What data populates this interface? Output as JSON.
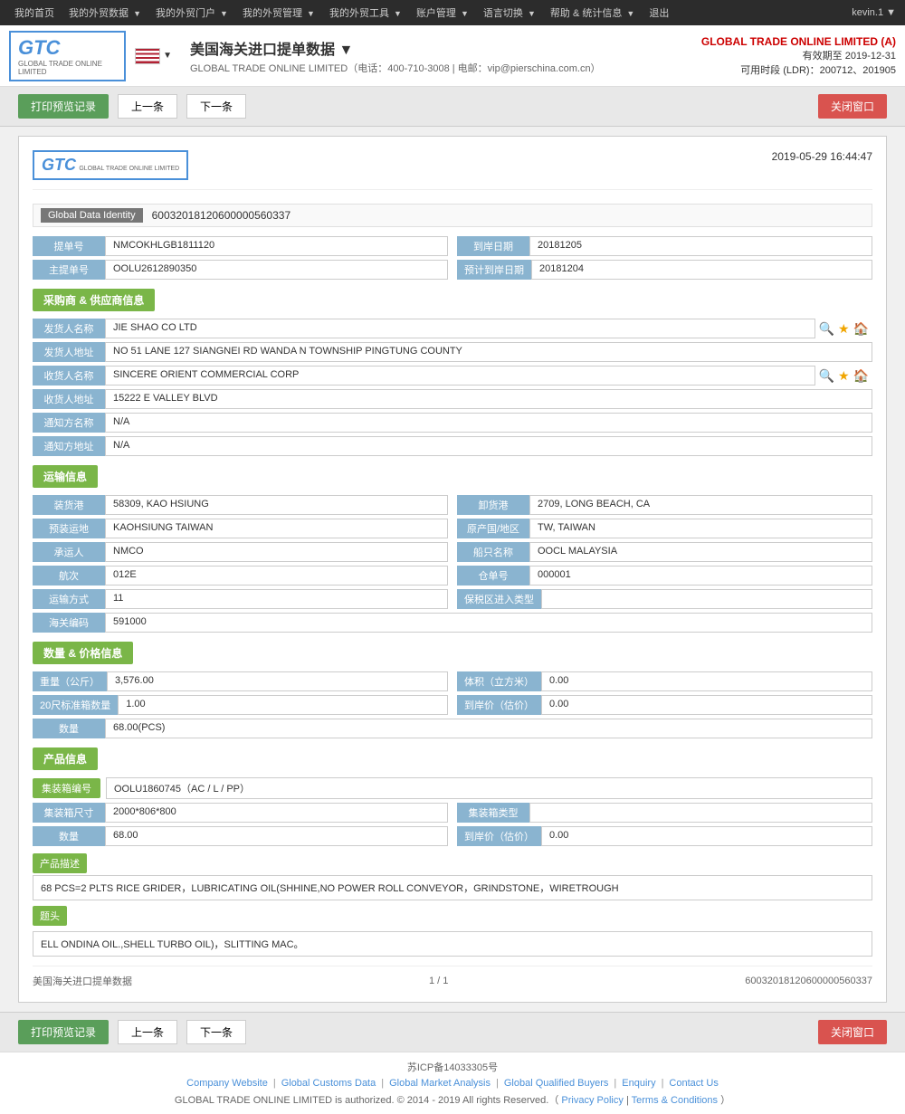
{
  "topnav": {
    "items": [
      {
        "label": "我的首页",
        "has_arrow": true
      },
      {
        "label": "我的外贸数据",
        "has_arrow": true
      },
      {
        "label": "我的外贸门户",
        "has_arrow": true
      },
      {
        "label": "我的外贸管理",
        "has_arrow": true
      },
      {
        "label": "我的外贸工具",
        "has_arrow": true
      },
      {
        "label": "账户管理",
        "has_arrow": true
      },
      {
        "label": "语言切换",
        "has_arrow": true
      },
      {
        "label": "帮助 & 统计信息",
        "has_arrow": true
      },
      {
        "label": "退出",
        "has_arrow": false
      }
    ],
    "user": "kevin.1 ▼"
  },
  "header": {
    "logo_main": "GTC",
    "logo_sub": "GLOBAL TRADE ONLINE LIMITED",
    "title": "美国海关进口提单数据",
    "title_suffix": "▼",
    "subtitle": "GLOBAL TRADE ONLINE LIMITED（电话：400-710-3008 | 电邮：vip@pierschina.com.cn）",
    "company": "GLOBAL TRADE ONLINE LIMITED (A)",
    "valid_until_label": "有效期至",
    "valid_until": "2019-12-31",
    "ldr_label": "可用时段 (LDR)：",
    "ldr_value": "200712、201905"
  },
  "toolbar_top": {
    "print_label": "打印预览记录",
    "prev_label": "上一条",
    "next_label": "下一条",
    "close_label": "关闭窗口"
  },
  "toolbar_bottom": {
    "print_label": "打印预览记录",
    "prev_label": "上一条",
    "next_label": "下一条",
    "close_label": "关闭窗口"
  },
  "card": {
    "logo_main": "GTC",
    "logo_sub": "GLOBAL TRADE ONLINE LIMITED",
    "datetime": "2019-05-29 16:44:47",
    "global_data_label": "Global Data Identity",
    "global_data_value": "60032018120600000560337",
    "bill_label": "提单号",
    "bill_value": "NMCOKHLGB1811120",
    "arrival_date_label": "到岸日期",
    "arrival_date_value": "20181205",
    "master_bill_label": "主提单号",
    "master_bill_value": "OOLU2612890350",
    "estimated_date_label": "预计到岸日期",
    "estimated_date_value": "20181204",
    "section_supplier": "采购商 & 供应商信息",
    "shipper_name_label": "发货人名称",
    "shipper_name_value": "JIE SHAO CO LTD",
    "shipper_addr_label": "发货人地址",
    "shipper_addr_value": "NO 51 LANE 127 SIANGNEI RD WANDA N TOWNSHIP PINGTUNG COUNTY",
    "consignee_name_label": "收货人名称",
    "consignee_name_value": "SINCERE ORIENT COMMERCIAL CORP",
    "consignee_addr_label": "收货人地址",
    "consignee_addr_value": "15222 E VALLEY BLVD",
    "notify_name_label": "通知方名称",
    "notify_name_value": "N/A",
    "notify_addr_label": "通知方地址",
    "notify_addr_value": "N/A",
    "section_transport": "运输信息",
    "loading_port_label": "装货港",
    "loading_port_value": "58309, KAO HSIUNG",
    "unloading_port_label": "卸货港",
    "unloading_port_value": "2709, LONG BEACH, CA",
    "pre_transport_label": "预装运地",
    "pre_transport_value": "KAOHSIUNG TAIWAN",
    "origin_label": "原产国/地区",
    "origin_value": "TW, TAIWAN",
    "carrier_label": "承运人",
    "carrier_value": "NMCO",
    "vessel_name_label": "船只名称",
    "vessel_name_value": "OOCL MALAYSIA",
    "voyage_label": "航次",
    "voyage_value": "012E",
    "warehouse_label": "仓单号",
    "warehouse_value": "000001",
    "transport_mode_label": "运输方式",
    "transport_mode_value": "11",
    "bonded_zone_label": "保税区进入类型",
    "bonded_zone_value": "",
    "customs_code_label": "海关编码",
    "customs_code_value": "591000",
    "section_quantity": "数量 & 价格信息",
    "weight_label": "重量（公斤）",
    "weight_value": "3,576.00",
    "volume_label": "体积（立方米）",
    "volume_value": "0.00",
    "std_box_20_label": "20尺标准箱数量",
    "std_box_20_value": "1.00",
    "arrival_price_label": "到岸价（估价）",
    "arrival_price_value": "0.00",
    "quantity_label": "数量",
    "quantity_value": "68.00(PCS)",
    "section_product": "产品信息",
    "container_no_label": "集装箱编号",
    "container_no_value": "OOLU1860745（AC / L / PP）",
    "container_size_label": "集装箱尺寸",
    "container_size_value": "2000*806*800",
    "container_type_label": "集装箱类型",
    "container_type_value": "",
    "product_qty_label": "数量",
    "product_qty_value": "68.00",
    "product_price_label": "到岸价（估价）",
    "product_price_value": "0.00",
    "product_desc_label": "产品描述",
    "product_desc_value": "68 PCS=2 PLTS RICE GRIDER，LUBRICATING OIL(SHHINE,NO POWER ROLL CONVEYOR，GRINDSTONE，WIRETROUGH",
    "head_label": "题头",
    "head_value": "ELL ONDINA OIL.,SHELL TURBO OIL)，SLITTING MAC。",
    "footer_title": "美国海关进口提单数据",
    "footer_page": "1 / 1",
    "footer_id": "60032018120600000560337"
  },
  "site_footer": {
    "icp": "苏ICP备14033305号",
    "links": [
      {
        "label": "Company Website"
      },
      {
        "label": "Global Customs Data"
      },
      {
        "label": "Global Market Analysis"
      },
      {
        "label": "Global Qualified Buyers"
      },
      {
        "label": "Enquiry"
      },
      {
        "label": "Contact Us"
      }
    ],
    "copyright": "GLOBAL TRADE ONLINE LIMITED is authorized. © 2014 - 2019 All rights Reserved.",
    "privacy_label": "Privacy Policy",
    "terms_label": "Terms & Conditions"
  }
}
